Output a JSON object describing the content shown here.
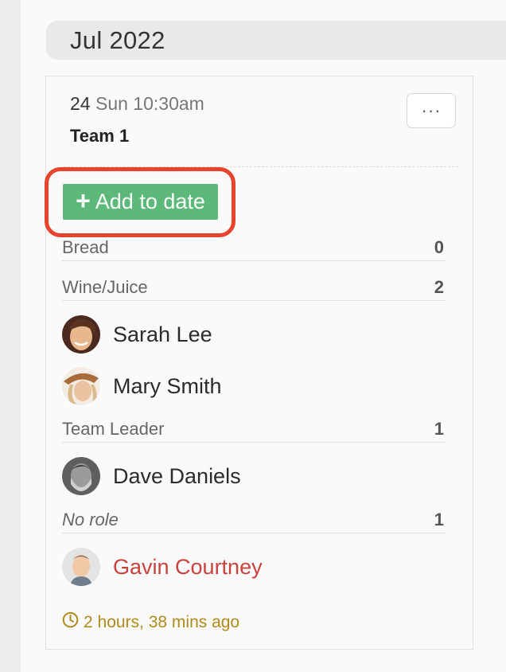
{
  "month_header": "Jul 2022",
  "event": {
    "day_number": "24",
    "day_time": "Sun 10:30am",
    "team": "Team 1",
    "more_label": "···",
    "add_button_label": "Add to date"
  },
  "rows": [
    {
      "label": "Bread",
      "count": "0"
    },
    {
      "label": "Wine/Juice",
      "count": "2"
    },
    {
      "label": "Team Leader",
      "count": "1"
    },
    {
      "label": "No role",
      "count": "1"
    }
  ],
  "people": [
    {
      "name": "Sarah Lee"
    },
    {
      "name": "Mary Smith"
    },
    {
      "name": "Dave Daniels"
    },
    {
      "name": "Gavin Courtney"
    }
  ],
  "timestamp": "2 hours, 38 mins ago",
  "colors": {
    "add_button": "#5cb97a",
    "highlight": "#e8432c",
    "warning_name": "#c9423c",
    "timestamp": "#b08a1c"
  },
  "icons": {
    "more": "ellipsis-icon",
    "add": "plus-icon",
    "timestamp": "clock-icon"
  }
}
